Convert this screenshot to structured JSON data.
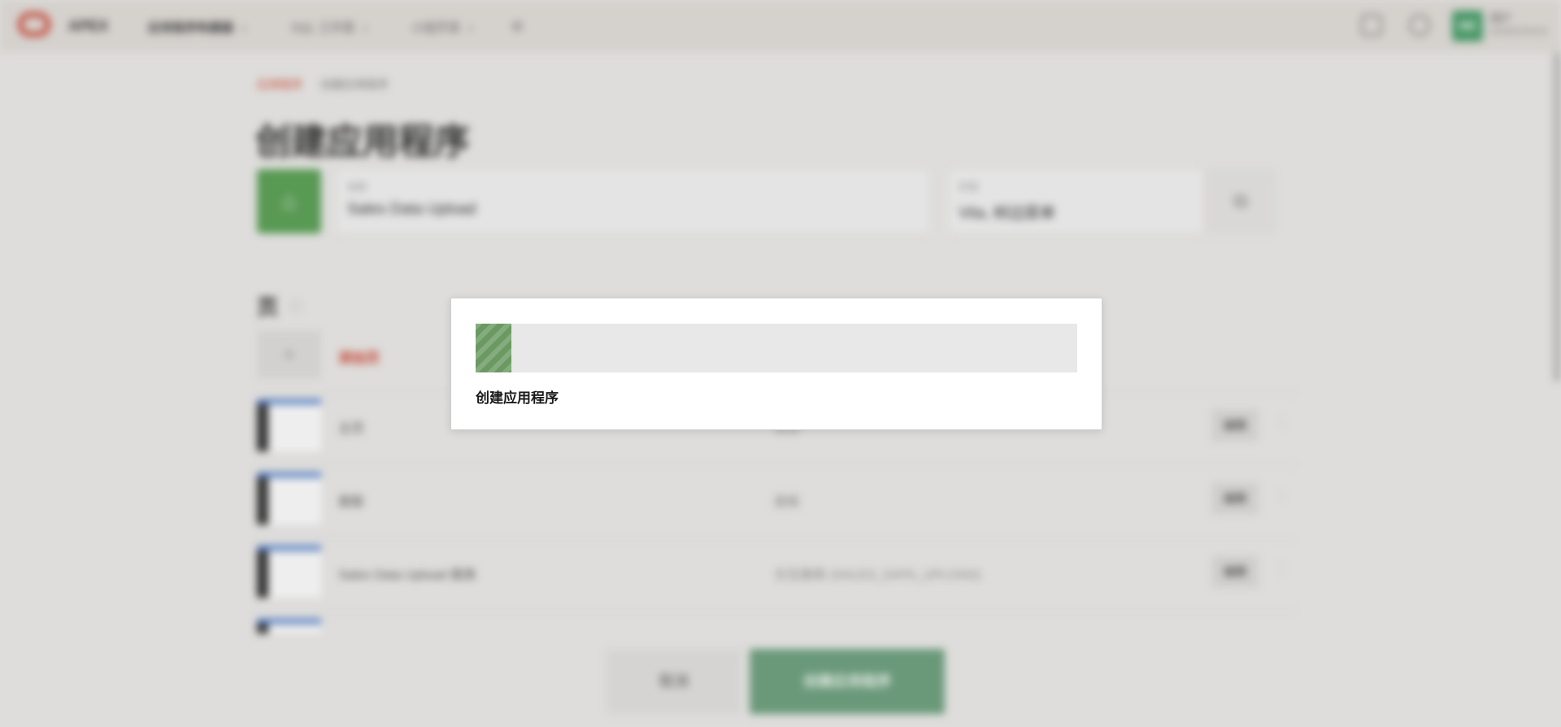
{
  "header": {
    "brand": "APEX",
    "nav": [
      {
        "label": "应用程序构建器"
      },
      {
        "label": "SQL 工作室"
      },
      {
        "label": "小组开发"
      },
      {
        "label": "⊞"
      }
    ],
    "user": {
      "initials": "WE",
      "name": "用户",
      "workspace": "WORKSPACE"
    }
  },
  "breadcrumb": {
    "home": "应用程序",
    "current": "创建应用程序"
  },
  "page_title": "创建应用程序",
  "app": {
    "name_label": "名称",
    "name_value": "Sales Data Upload",
    "theme_label": "外观",
    "theme_value": "Vita, 树边菜单"
  },
  "pages": {
    "title": "页",
    "add_label": "添加页",
    "rows": [
      {
        "name": "主页",
        "type": "空白",
        "edit": "编辑"
      },
      {
        "name": "面板",
        "type": "面板",
        "edit": "编辑"
      },
      {
        "name": "Sales Data Upload 报表",
        "type": "交互报表 (SALES_DATA_UPLOAD)",
        "edit": "编辑"
      },
      {
        "name": "",
        "type": "",
        "edit": ""
      }
    ]
  },
  "footer": {
    "cancel": "取消",
    "create": "创建应用程序"
  },
  "dialog": {
    "progress": 0.06,
    "message": "创建应用程序",
    "bar_color": "#6a9a61"
  }
}
